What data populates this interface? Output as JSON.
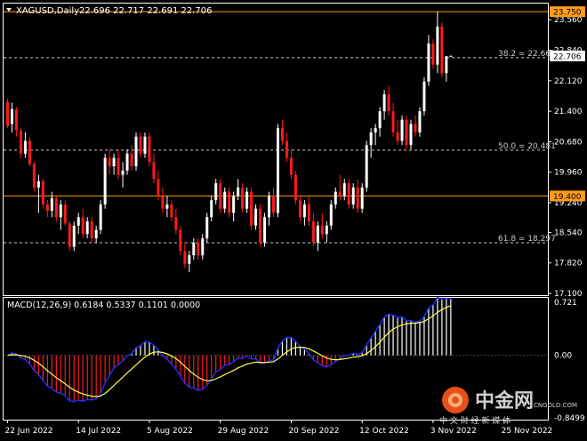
{
  "header": {
    "symbol": "XAGUSD,Daily",
    "ohlc": "22.696 22.717 22.691 22.706"
  },
  "colors": {
    "background": "#000000",
    "frame": "#ffffff",
    "bull": "#ffffff",
    "bear": "#ff1a1a",
    "fib_line": "#c8c8c8",
    "hline": "#ff9c1a",
    "label_hl_bg": "#ff9c1a",
    "macd_line": "#1e2fff",
    "signal_line": "#ffff4d",
    "hist_pos": "#ffffff",
    "hist_neg": "#ff1a1a"
  },
  "price_axis": {
    "ticks": [
      "23.560",
      "22.840",
      "22.120",
      "21.400",
      "20.680",
      "19.960",
      "19.240",
      "18.540",
      "17.820",
      "17.100"
    ],
    "tick_values": [
      23.56,
      22.84,
      22.12,
      21.4,
      20.68,
      19.96,
      19.24,
      18.54,
      17.82,
      17.1
    ],
    "label_top": "23.750",
    "label_current": "22.706",
    "label_mid": "19.400"
  },
  "fib_levels": [
    {
      "label": "38.2 = 22.665",
      "value": 22.665
    },
    {
      "label": "50.0 = 20.481",
      "value": 20.481
    },
    {
      "label": "61.8 = 18.297",
      "value": 18.297
    }
  ],
  "macd": {
    "title": "MACD(12,26,9) 0.6184 0.5337 0.1101 0.0000",
    "ticks": [
      "0.721",
      "0.00",
      "-0.8499"
    ],
    "tick_values": [
      0.721,
      0.0,
      -0.8499
    ]
  },
  "x_axis": {
    "labels": [
      "22 Jun 2022",
      "14 Jul 2022",
      "5 Aug 2022",
      "29 Aug 2022",
      "20 Sep 2022",
      "12 Oct 2022",
      "3 Nov 2022",
      "25 Nov 2022"
    ],
    "label_bar_index": [
      0,
      16,
      32,
      48,
      64,
      80,
      96,
      112
    ]
  },
  "watermark": {
    "title": "中金网",
    "url": "CNGOLD.COM",
    "slogan": "中 文 财 经 新 媒 体"
  },
  "chart_data": {
    "type": "candlestick",
    "title": "XAGUSD,Daily",
    "ylim": [
      17.1,
      23.9
    ],
    "hlines": [
      23.75,
      19.4
    ],
    "candles": [
      [
        21.62,
        21.7,
        21.0,
        21.05
      ],
      [
        21.1,
        21.6,
        20.9,
        21.45
      ],
      [
        21.45,
        21.5,
        20.8,
        20.95
      ],
      [
        20.95,
        21.0,
        20.3,
        20.4
      ],
      [
        20.4,
        20.9,
        20.3,
        20.7
      ],
      [
        20.7,
        20.8,
        20.1,
        20.15
      ],
      [
        20.15,
        20.2,
        19.5,
        19.6
      ],
      [
        19.6,
        19.9,
        19.0,
        19.75
      ],
      [
        19.75,
        19.8,
        19.1,
        19.2
      ],
      [
        19.2,
        19.3,
        18.9,
        19.05
      ],
      [
        19.05,
        19.5,
        18.9,
        19.35
      ],
      [
        19.35,
        19.4,
        18.8,
        18.9
      ],
      [
        18.9,
        19.3,
        18.6,
        19.2
      ],
      [
        19.2,
        19.3,
        18.7,
        18.75
      ],
      [
        18.75,
        18.8,
        18.1,
        18.2
      ],
      [
        18.2,
        18.8,
        18.1,
        18.7
      ],
      [
        18.7,
        19.0,
        18.5,
        18.9
      ],
      [
        18.9,
        19.1,
        18.4,
        18.5
      ],
      [
        18.5,
        18.9,
        18.4,
        18.8
      ],
      [
        18.8,
        18.9,
        18.3,
        18.4
      ],
      [
        18.4,
        18.7,
        18.3,
        18.6
      ],
      [
        18.6,
        19.3,
        18.5,
        19.2
      ],
      [
        19.2,
        20.4,
        19.1,
        20.3
      ],
      [
        20.3,
        20.5,
        19.9,
        20.1
      ],
      [
        20.1,
        20.4,
        19.9,
        20.3
      ],
      [
        20.3,
        20.5,
        19.8,
        19.9
      ],
      [
        19.9,
        20.2,
        19.6,
        20.0
      ],
      [
        20.0,
        20.5,
        19.9,
        20.4
      ],
      [
        20.4,
        20.6,
        20.0,
        20.1
      ],
      [
        20.1,
        20.9,
        20.0,
        20.8
      ],
      [
        20.8,
        20.9,
        20.3,
        20.4
      ],
      [
        20.4,
        20.9,
        20.3,
        20.8
      ],
      [
        20.8,
        20.9,
        20.1,
        20.2
      ],
      [
        20.2,
        20.4,
        19.7,
        19.8
      ],
      [
        19.8,
        20.0,
        19.3,
        19.4
      ],
      [
        19.4,
        19.6,
        19.0,
        19.1
      ],
      [
        19.1,
        19.4,
        18.9,
        19.2
      ],
      [
        19.2,
        19.3,
        18.8,
        18.9
      ],
      [
        18.9,
        19.1,
        18.5,
        18.6
      ],
      [
        18.6,
        18.7,
        18.0,
        18.1
      ],
      [
        18.1,
        18.3,
        17.7,
        17.8
      ],
      [
        17.8,
        18.1,
        17.6,
        18.0
      ],
      [
        18.0,
        18.4,
        17.9,
        18.3
      ],
      [
        18.3,
        18.4,
        17.9,
        18.0
      ],
      [
        18.0,
        18.5,
        17.9,
        18.4
      ],
      [
        18.4,
        19.0,
        18.3,
        18.9
      ],
      [
        18.9,
        19.4,
        18.8,
        19.3
      ],
      [
        19.3,
        19.8,
        19.2,
        19.7
      ],
      [
        19.7,
        19.8,
        19.0,
        19.1
      ],
      [
        19.1,
        19.6,
        19.0,
        19.5
      ],
      [
        19.5,
        19.6,
        18.9,
        19.0
      ],
      [
        19.0,
        19.5,
        18.8,
        19.4
      ],
      [
        19.4,
        19.8,
        19.3,
        19.6
      ],
      [
        19.6,
        19.7,
        19.0,
        19.1
      ],
      [
        19.1,
        19.6,
        19.0,
        19.5
      ],
      [
        19.5,
        19.6,
        18.6,
        18.7
      ],
      [
        18.7,
        19.2,
        18.6,
        19.1
      ],
      [
        19.1,
        19.2,
        18.2,
        18.3
      ],
      [
        18.3,
        19.0,
        18.2,
        18.9
      ],
      [
        18.9,
        19.5,
        18.7,
        19.4
      ],
      [
        19.4,
        19.6,
        18.9,
        19.0
      ],
      [
        19.0,
        21.1,
        18.9,
        21.0
      ],
      [
        21.0,
        21.2,
        20.6,
        20.7
      ],
      [
        20.7,
        20.9,
        20.2,
        20.3
      ],
      [
        20.3,
        20.5,
        19.8,
        19.9
      ],
      [
        19.9,
        20.0,
        19.2,
        19.3
      ],
      [
        19.3,
        19.4,
        18.8,
        18.9
      ],
      [
        18.9,
        19.3,
        18.7,
        19.2
      ],
      [
        19.2,
        19.4,
        18.7,
        18.8
      ],
      [
        18.8,
        19.0,
        18.2,
        18.3
      ],
      [
        18.3,
        18.8,
        18.1,
        18.7
      ],
      [
        18.7,
        19.0,
        18.4,
        18.5
      ],
      [
        18.5,
        18.8,
        18.3,
        18.7
      ],
      [
        18.7,
        19.3,
        18.6,
        19.2
      ],
      [
        19.2,
        19.6,
        19.1,
        19.5
      ],
      [
        19.5,
        19.9,
        19.3,
        19.4
      ],
      [
        19.4,
        19.8,
        19.3,
        19.7
      ],
      [
        19.7,
        19.8,
        19.1,
        19.2
      ],
      [
        19.2,
        19.7,
        19.1,
        19.6
      ],
      [
        19.6,
        19.8,
        19.0,
        19.1
      ],
      [
        19.1,
        19.7,
        19.0,
        19.6
      ],
      [
        19.6,
        20.7,
        19.5,
        20.6
      ],
      [
        20.6,
        21.0,
        20.3,
        20.9
      ],
      [
        20.9,
        21.1,
        20.6,
        21.0
      ],
      [
        21.0,
        21.5,
        20.8,
        21.4
      ],
      [
        21.4,
        21.9,
        21.2,
        21.8
      ],
      [
        21.8,
        22.0,
        21.3,
        21.4
      ],
      [
        21.4,
        21.6,
        20.8,
        20.9
      ],
      [
        20.9,
        21.2,
        20.6,
        20.7
      ],
      [
        20.7,
        21.3,
        20.6,
        21.2
      ],
      [
        21.2,
        21.3,
        20.5,
        20.6
      ],
      [
        20.6,
        21.2,
        20.5,
        21.1
      ],
      [
        21.1,
        21.3,
        20.8,
        20.9
      ],
      [
        20.9,
        21.5,
        20.8,
        21.4
      ],
      [
        21.4,
        22.2,
        21.3,
        22.1
      ],
      [
        22.1,
        23.2,
        22.0,
        23.0
      ],
      [
        23.0,
        23.1,
        22.4,
        22.5
      ],
      [
        22.5,
        23.75,
        22.3,
        23.4
      ],
      [
        23.4,
        23.5,
        22.2,
        22.3
      ],
      [
        22.3,
        22.7,
        22.1,
        22.7
      ],
      [
        22.7,
        22.72,
        22.69,
        22.706
      ]
    ]
  }
}
